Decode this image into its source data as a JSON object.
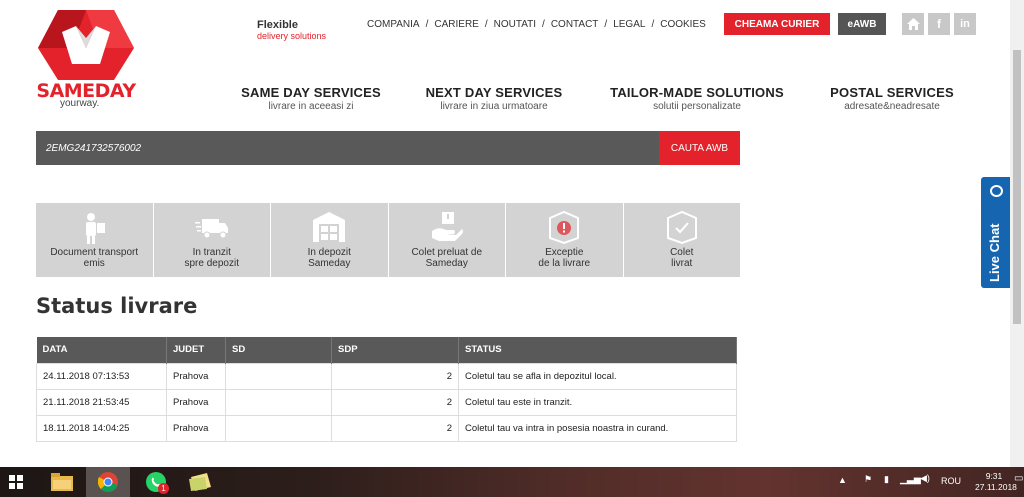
{
  "header": {
    "logo_text": "SAMEDAY",
    "logo_sub": "yourway.",
    "tagline_main": "Flexible",
    "tagline_sub": "delivery solutions",
    "top_links": [
      "COMPANIA",
      "CARIERE",
      "NOUTATI",
      "CONTACT",
      "LEGAL",
      "COOKIES"
    ],
    "courier_button": "CHEAMA CURIER",
    "eawb_button": "eAWB",
    "social": [
      "home-icon",
      "facebook-icon",
      "linkedin-icon"
    ],
    "main_nav": [
      {
        "title": "SAME DAY SERVICES",
        "sub": "livrare in aceeasi zi"
      },
      {
        "title": "NEXT DAY SERVICES",
        "sub": "livrare in ziua urmatoare"
      },
      {
        "title": "TAILOR-MADE SOLUTIONS",
        "sub": "solutii personalizate"
      },
      {
        "title": "POSTAL SERVICES",
        "sub": "adresate&neadresate"
      }
    ]
  },
  "search": {
    "awb_value": "2EMG241732576002",
    "button": "CAUTA AWB"
  },
  "steps": [
    {
      "label": "Document transport\nemis",
      "icon": "person-document-icon"
    },
    {
      "label": "In tranzit\nspre depozit",
      "icon": "delivery-truck-icon"
    },
    {
      "label": "In depozit\nSameday",
      "icon": "warehouse-icon"
    },
    {
      "label": "Colet preluat de\nSameday",
      "icon": "hand-package-icon"
    },
    {
      "label": "Exceptie\nde la livrare",
      "icon": "box-exception-icon"
    },
    {
      "label": "Colet\nlivrat",
      "icon": "box-check-icon"
    }
  ],
  "status_title": "Status livrare",
  "table": {
    "headers": [
      "DATA",
      "JUDET",
      "SD",
      "SDP",
      "STATUS"
    ],
    "rows": [
      {
        "data": "24.11.2018 07:13:53",
        "judet": "Prahova",
        "sd": "",
        "sdp": "2",
        "status": "Coletul tau se afla in depozitul local."
      },
      {
        "data": "21.11.2018 21:53:45",
        "judet": "Prahova",
        "sd": "",
        "sdp": "2",
        "status": "Coletul tau este in tranzit."
      },
      {
        "data": "18.11.2018 14:04:25",
        "judet": "Prahova",
        "sd": "",
        "sdp": "2",
        "status": "Coletul tau va intra in posesia noastra in curand."
      }
    ]
  },
  "live_chat": "Live Chat",
  "taskbar": {
    "language": "ROU",
    "time": "9:31",
    "date": "27.11.2018",
    "whatsapp_badge": "1"
  },
  "colors": {
    "brand_red": "#e3222b",
    "dark_gray": "#595959",
    "step_gray": "#d3d3d3",
    "chat_blue": "#1565b0"
  }
}
